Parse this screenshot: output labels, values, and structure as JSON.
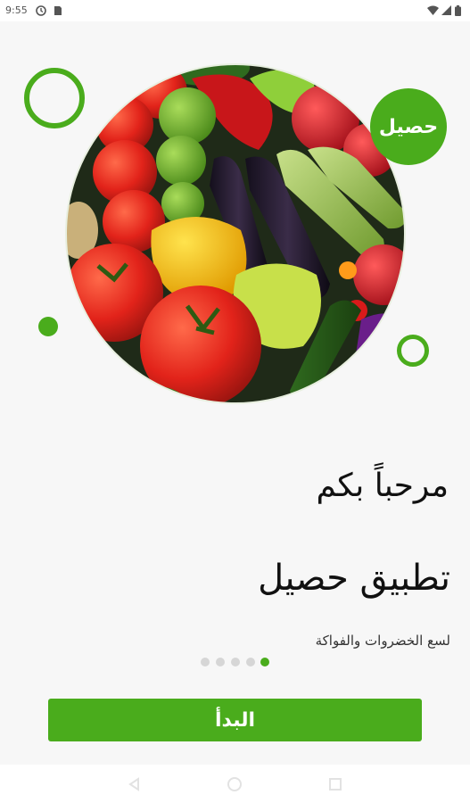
{
  "status_bar": {
    "time": "9:55",
    "left_icons": [
      "sync-icon",
      "sim-card-icon"
    ],
    "right_icons": [
      "wifi-icon",
      "cellular-icon",
      "battery-icon"
    ]
  },
  "hero": {
    "image": "fresh-vegetables-photo"
  },
  "brand_badge": {
    "label": "حصيل"
  },
  "onboarding": {
    "welcome": "مرحباً بكم",
    "app_name": "تطبيق حصيل",
    "subtitle": "لسع الخضروات والفواكة",
    "page_count": 5,
    "active_page": 5
  },
  "start_button": {
    "label": "البدأ"
  },
  "nav_bar": {
    "buttons": [
      "back-icon",
      "home-icon",
      "recents-icon"
    ]
  },
  "colors": {
    "accent": "#4aac1c",
    "background": "#f7f7f7",
    "inactive_dot": "#d6d6d6"
  }
}
